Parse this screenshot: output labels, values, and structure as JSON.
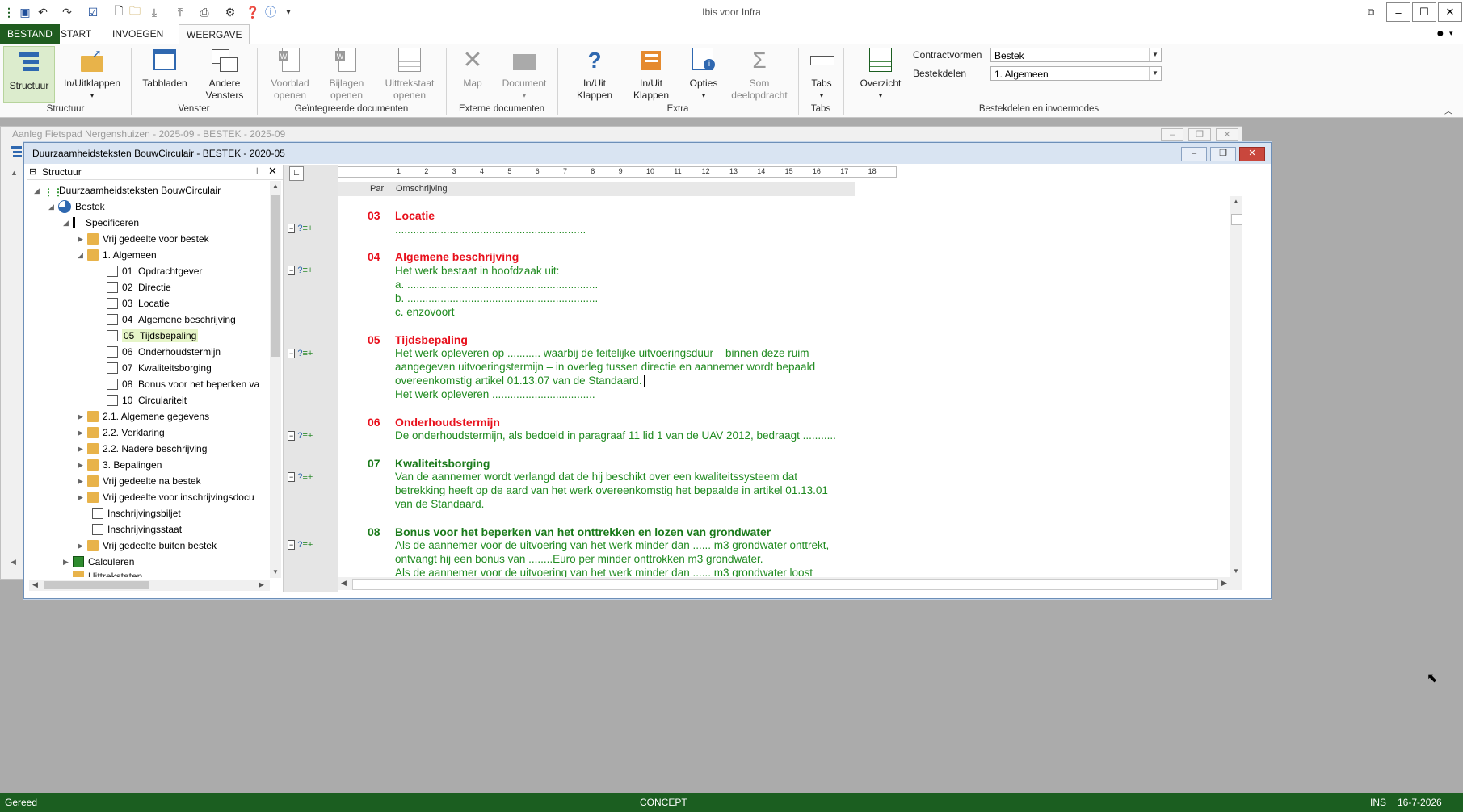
{
  "app": {
    "title": "Ibis voor Infra"
  },
  "ribbon_tabs": [
    "BESTAND",
    "START",
    "INVOEGEN",
    "WEERGAVE"
  ],
  "ribbon": {
    "structuur": "Structuur",
    "inuitklappen": "In/Uitklappen",
    "tabbladen": "Tabbladen",
    "andere_vensters": "Andere Vensters",
    "voorblad": "Voorblad openen",
    "bijlagen": "Bijlagen openen",
    "uittrekstaat": "Uittrekstaat openen",
    "map": "Map",
    "document": "Document",
    "inuit_klappen1": "In/Uit Klappen",
    "inuit_klappen2": "In/Uit Klappen",
    "opties": "Opties",
    "som": "Som deelopdracht",
    "tabs": "Tabs",
    "overzicht": "Overzicht",
    "groups": {
      "structuur": "Structuur",
      "venster": "Venster",
      "geintegreerde": "Geïntegreerde documenten",
      "externe": "Externe documenten",
      "extra": "Extra",
      "tabs": "Tabs",
      "bestekdelen": "Bestekdelen en invoermodes"
    },
    "contractvormen_label": "Contractvormen",
    "contractvormen_value": "Bestek",
    "bestekdelen_label": "Bestekdelen",
    "bestekdelen_value": "1. Algemeen"
  },
  "bg_window": {
    "title": "Aanleg Fietspad Nergenshuizen - 2025-09 - BESTEK - 2025-09"
  },
  "fg_window": {
    "title": "Duurzaamheidsteksten BouwCirculair - BESTEK - 2020-05"
  },
  "tree": {
    "header": "Structuur",
    "root": "Duurzaamheidsteksten BouwCirculair",
    "bestek": "Bestek",
    "specificeren": "Specificeren",
    "vrij_voor": "Vrij gedeelte voor bestek",
    "algemeen": "1. Algemeen",
    "items": [
      {
        "num": "01",
        "label": "Opdrachtgever"
      },
      {
        "num": "02",
        "label": "Directie"
      },
      {
        "num": "03",
        "label": "Locatie"
      },
      {
        "num": "04",
        "label": "Algemene beschrijving"
      },
      {
        "num": "05",
        "label": "Tijdsbepaling"
      },
      {
        "num": "06",
        "label": "Onderhoudstermijn"
      },
      {
        "num": "07",
        "label": "Kwaliteitsborging"
      },
      {
        "num": "08",
        "label": "Bonus voor het beperken va"
      },
      {
        "num": "10",
        "label": "Circulariteit"
      }
    ],
    "more": [
      "2.1. Algemene gegevens",
      "2.2. Verklaring",
      "2.2. Nadere beschrijving",
      "3. Bepalingen",
      "Vrij gedeelte na bestek",
      "Vrij gedeelte voor inschrijvingsdocu",
      "Inschrijvingsbiljet",
      "Inschrijvingsstaat",
      "Vrij gedeelte buiten bestek"
    ],
    "calculeren": "Calculeren",
    "uittrekstaten": "Uittrekstaten"
  },
  "columns": {
    "par": "Par",
    "omschrijving": "Omschrijving"
  },
  "ruler_marks": [
    "1",
    "2",
    "3",
    "4",
    "5",
    "6",
    "7",
    "8",
    "9",
    "10",
    "11",
    "12",
    "13",
    "14",
    "15",
    "16",
    "17",
    "18"
  ],
  "document": {
    "s03": {
      "num": "03",
      "title": "Locatie",
      "lines": [
        "..............................................................."
      ]
    },
    "s04": {
      "num": "04",
      "title": "Algemene beschrijving",
      "lines": [
        "Het werk bestaat in hoofdzaak uit:",
        "a.    ...............................................................",
        "b.    ...............................................................",
        "c.    enzovoort"
      ]
    },
    "s05": {
      "num": "05",
      "title": "Tijdsbepaling",
      "lines": [
        "Het werk opleveren op ........... waarbij de feitelijke uitvoeringsduur – binnen deze ruim",
        "aangegeven uitvoeringstermijn – in overleg tussen directie en aannemer wordt bepaald",
        "overeenkomstig artikel 01.13.07 van de Standaard.",
        "Het werk opleveren .................................."
      ]
    },
    "s06": {
      "num": "06",
      "title": "Onderhoudstermijn",
      "lines": [
        "De onderhoudstermijn, als bedoeld in paragraaf 11 lid 1 van de UAV 2012, bedraagt ..........."
      ]
    },
    "s07": {
      "num": "07",
      "title": "Kwaliteitsborging",
      "lines": [
        "Van de aannemer wordt verlangd dat de hij beschikt over een kwaliteitssysteem dat",
        "betrekking heeft op de aard van het werk overeenkomstig het bepaalde in artikel 01.13.01",
        "van de Standaard."
      ]
    },
    "s08": {
      "num": "08",
      "title": "Bonus voor het beperken van het onttrekken en lozen van grondwater",
      "lines": [
        "Als de aannemer voor de uitvoering van het werk minder dan ...... m3 grondwater onttrekt,",
        "ontvangt hij een bonus van ........Euro per minder onttrokken m3 grondwater.",
        "Als de aannemer voor de uitvoering van het werk minder dan ...... m3 grondwater loost"
      ]
    }
  },
  "status": {
    "left": "Gereed",
    "center": "CONCEPT",
    "ins": "INS",
    "date": "16-7-2026"
  },
  "colors": {
    "accent_green": "#1b5e20",
    "red_heading": "#e8101c",
    "green_text": "#1a7a1a"
  }
}
